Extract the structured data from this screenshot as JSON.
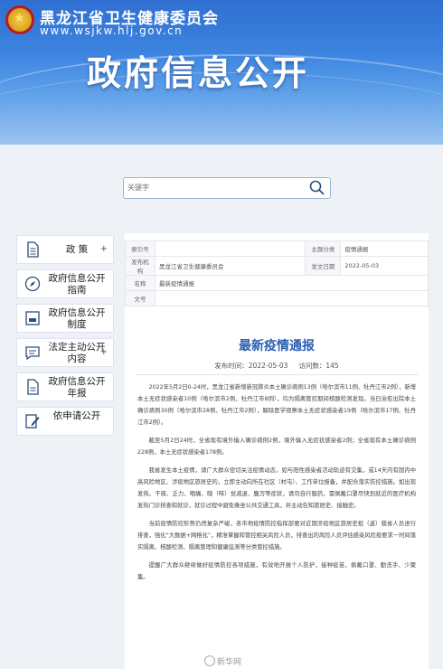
{
  "header": {
    "org_name": "黑龙江省卫生健康委员会",
    "url": "www.wsjkw.hlj.gov.cn",
    "title": "政府信息公开"
  },
  "search": {
    "placeholder": "关键字"
  },
  "sidebar": {
    "items": [
      {
        "label": "政 策",
        "icon": "document-icon",
        "plus": "+"
      },
      {
        "label": "政府信息公开指南",
        "icon": "compass-icon"
      },
      {
        "label": "政府信息公开制度",
        "icon": "book-icon"
      },
      {
        "label": "法定主动公开内容",
        "icon": "chat-list-icon",
        "plus": "+"
      },
      {
        "label": "政府信息公开年报",
        "icon": "report-icon"
      },
      {
        "label": "依申请公开",
        "icon": "edit-icon"
      }
    ]
  },
  "meta": {
    "index_label": "索引号",
    "index_value": "",
    "topic_label": "主题分类",
    "topic_value": "疫情通报",
    "publisher_label": "发布机构",
    "publisher_value": "黑龙江省卫生健康委员会",
    "pubdate_label": "发文日期",
    "pubdate_value": "2022-05-03",
    "name_label": "名称",
    "name_value": "最新疫情通报",
    "docno_label": "文号",
    "docno_value": ""
  },
  "article": {
    "title": "最新疫情通报",
    "date": "发布时间：2022-05-03",
    "views": "访问数：145",
    "paragraphs": [
      "2022年5月2日0-24时，黑龙江省新增新冠肺炎本土确诊病例13例（哈尔滨市11例、牡丹江市2例），新增本土无症状感染者10例（哈尔滨市2例、牡丹江市8例），均为隔离管控期间核酸检测发现。当日治愈出院本土确诊病例30例（哈尔滨市28例、牡丹江市2例），解除医学观察本土无症状感染者19例（哈尔滨市17例、牡丹江市2例）。",
      "截至5月2日24时，全省现有境外输入确诊病例2例，境外输入无症状感染者2例；全省现有本土确诊病例228例，本土无症状感染者178例。",
      "我省发生本土疫情，请广大群众密切关注疫情动态，如与阳性感染者活动轨迹有交集，或14天内有国内中高风险地区、涉疫地区旅居史的，立即主动向所在社区（村屯）、工作单位报备，并配合落实防控措施。如出现发热、干咳、乏力、咽痛、嗅（味）觉减退、腹泻等症状，请勿自行服药，需佩戴口罩尽快到就近的医疗机构发热门诊排查和就诊，就诊过程中避免乘坐公共交通工具，并主动告知旅居史、接触史。",
      "当前疫情防控形势仍然复杂严峻，各市地疫情防控指挥部要对近期涉疫地区旅居史抵（返）我省人员进行排查，强化“大数据+网格化”，精准掌握和管控相关风险人员，排查出的风险人员评估感染风险按要求一时间落实隔离、核酸检测、隔离管理和健康监测等分类管控措施。",
      "提醒广大群众继续做好疫情防控各项措施，有效地开展个人防护，接种疫苗，佩戴口罩、勤洗手、少聚集。"
    ]
  },
  "watermark": "新华网",
  "colors": {
    "banner": "#3d85e0",
    "title_blue": "#2b5fb3"
  }
}
